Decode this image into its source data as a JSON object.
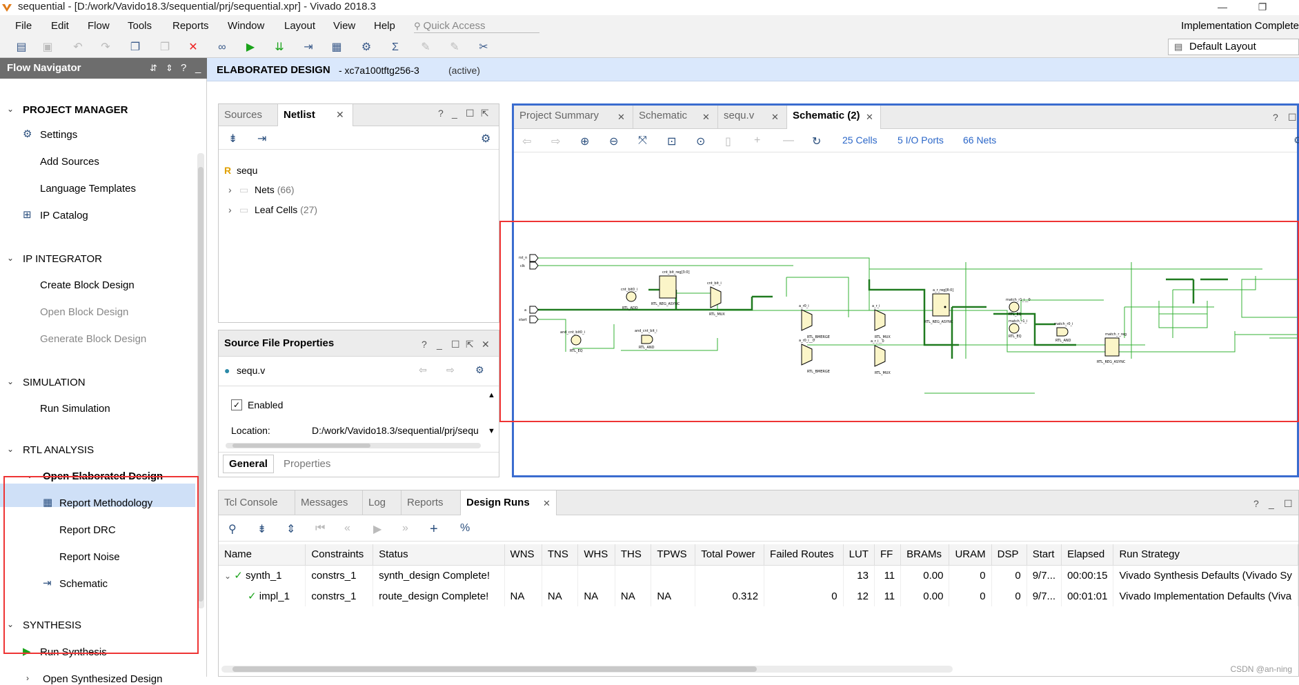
{
  "window": {
    "title": "sequential - [D:/work/Vavido18.3/sequential/prj/sequential.xpr] - Vivado 2018.3",
    "minimize": "—",
    "restore": "❐",
    "close": "✕"
  },
  "menu": {
    "items": [
      "File",
      "Edit",
      "Flow",
      "Tools",
      "Reports",
      "Window",
      "Layout",
      "View",
      "Help"
    ],
    "quick_access_placeholder": "Quick Access",
    "status": "Implementation Complete"
  },
  "toolbar": {
    "layout_select": "Default Layout"
  },
  "flow_navigator": {
    "title": "Flow Navigator",
    "sections": [
      {
        "label": "PROJECT MANAGER",
        "items": [
          "Settings",
          "Add Sources",
          "Language Templates",
          "IP Catalog"
        ]
      },
      {
        "label": "IP INTEGRATOR",
        "items": [
          "Create Block Design",
          "Open Block Design",
          "Generate Block Design"
        ]
      },
      {
        "label": "SIMULATION",
        "items": [
          "Run Simulation"
        ]
      },
      {
        "label": "RTL ANALYSIS",
        "sub": "Open Elaborated Design",
        "items": [
          "Report Methodology",
          "Report DRC",
          "Report Noise",
          "Schematic"
        ]
      },
      {
        "label": "SYNTHESIS",
        "items": [
          "Run Synthesis",
          "Open Synthesized Design"
        ]
      }
    ]
  },
  "design_header": {
    "title": "ELABORATED DESIGN",
    "part": "- xc7a100tftg256-3",
    "state": "(active)"
  },
  "sources_panel": {
    "tabs": [
      "Sources",
      "Netlist"
    ],
    "help": "?",
    "root": "sequ",
    "root_icon": "R",
    "nodes": [
      {
        "label": "Nets",
        "count": "(66)"
      },
      {
        "label": "Leaf Cells",
        "count": "(27)"
      }
    ]
  },
  "sfp_panel": {
    "title": "Source File Properties",
    "file": "sequ.v",
    "enabled_label": "Enabled",
    "location_label": "Location:",
    "location_value": "D:/work/Vavido18.3/sequential/prj/sequ",
    "tabs": [
      "General",
      "Properties"
    ]
  },
  "schematic_panel": {
    "tabs": [
      "Project Summary",
      "Schematic",
      "sequ.v",
      "Schematic (2)"
    ],
    "cells": "25 Cells",
    "ports": "5 I/O Ports",
    "nets": "66 Nets",
    "diagram": {
      "ports": [
        "rst_n",
        "clk",
        "a",
        "start"
      ],
      "blocks": [
        {
          "label": "cnt_bit0_i",
          "type": "RTL_ADD"
        },
        {
          "label": "cnt_bit_i",
          "type": "RTL_MUX"
        },
        {
          "label": "cnt_bit_reg[3:0]",
          "type": "RTL_REG_ASYNC"
        },
        {
          "label": "and_cnt_bit0_i",
          "type": "RTL_EQ"
        },
        {
          "label": "and_cnt_bit_i",
          "type": "RTL_AND"
        },
        {
          "label": "a_r0_i",
          "type": "RTL_BMERGE"
        },
        {
          "label": "a_r0_i__0",
          "type": "RTL_BMERGE"
        },
        {
          "label": "a_r_i",
          "type": "RTL_MUX"
        },
        {
          "label": "a_r_i__0",
          "type": "RTL_MUX"
        },
        {
          "label": "a_r_reg[8:0]",
          "type": "RTL_REG_ASYNC"
        },
        {
          "label": "match_r1_i__0",
          "type": "RTL_EQ"
        },
        {
          "label": "match_r1_i",
          "type": "RTL_EQ"
        },
        {
          "label": "match_r0_i",
          "type": "RTL_AND"
        },
        {
          "label": "match_r_reg",
          "type": "RTL_REG_ASYNC"
        }
      ]
    }
  },
  "runs_panel": {
    "tabs": [
      "Tcl Console",
      "Messages",
      "Log",
      "Reports",
      "Design Runs"
    ],
    "columns": [
      "Name",
      "Constraints",
      "Status",
      "WNS",
      "TNS",
      "WHS",
      "THS",
      "TPWS",
      "Total Power",
      "Failed Routes",
      "LUT",
      "FF",
      "BRAMs",
      "URAM",
      "DSP",
      "Start",
      "Elapsed",
      "Run Strategy"
    ],
    "rows": [
      {
        "name": "synth_1",
        "constraints": "constrs_1",
        "status": "synth_design Complete!",
        "wns": "",
        "tns": "",
        "whs": "",
        "ths": "",
        "tpws": "",
        "power": "",
        "failed": "",
        "lut": "13",
        "ff": "11",
        "brams": "0.00",
        "uram": "0",
        "dsp": "0",
        "start": "9/7...",
        "elapsed": "00:00:15",
        "strategy": "Vivado Synthesis Defaults (Vivado Sy"
      },
      {
        "name": "impl_1",
        "constraints": "constrs_1",
        "status": "route_design Complete!",
        "wns": "NA",
        "tns": "NA",
        "whs": "NA",
        "ths": "NA",
        "tpws": "NA",
        "power": "0.312",
        "failed": "0",
        "lut": "12",
        "ff": "11",
        "brams": "0.00",
        "uram": "0",
        "dsp": "0",
        "start": "9/7...",
        "elapsed": "00:01:01",
        "strategy": "Vivado Implementation Defaults (Viva"
      }
    ]
  },
  "watermark": "CSDN @an-ning",
  "colors": {
    "accent": "#3a6ccf",
    "highlight_box": "#e33333",
    "nav_header": "#6d6d6d",
    "ok_green": "#1aa31a",
    "wire_green": "#2fae2f"
  }
}
